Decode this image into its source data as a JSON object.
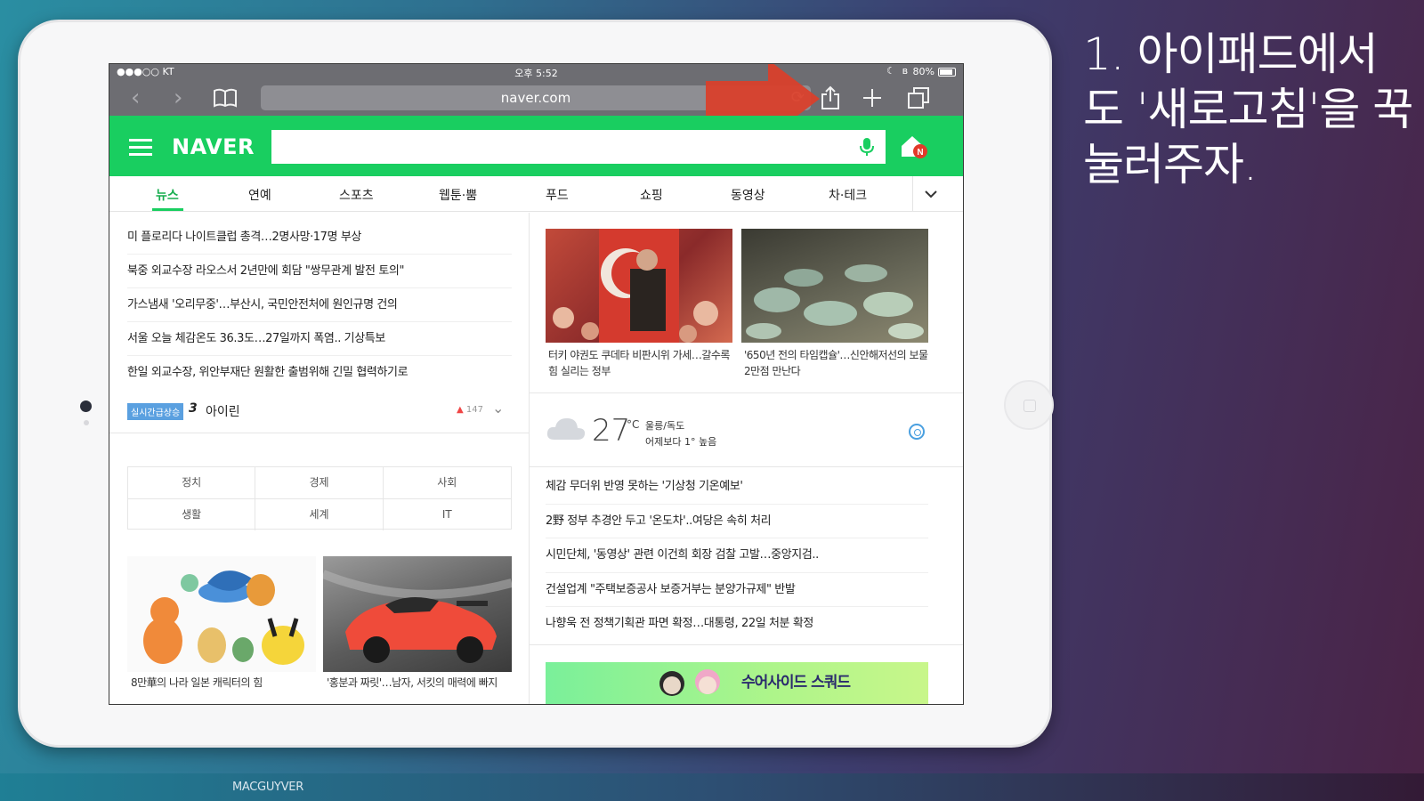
{
  "caption": {
    "line1": "1. 아이패드에서",
    "line2": "도 '새로고침'을 꾹",
    "line3": "눌러주자."
  },
  "footer": {
    "label": "MACGUYVER"
  },
  "statusbar": {
    "carrier": "●●●○○ KT",
    "time": "오후 5:52",
    "battery": "80%"
  },
  "browser": {
    "url": "naver.com",
    "icons": [
      "back-icon",
      "forward-icon",
      "bookmarks-icon",
      "reload-icon",
      "share-icon",
      "new-tab-icon",
      "tabs-icon"
    ]
  },
  "naver": {
    "logo": "NAVER",
    "search_placeholder": ""
  },
  "tabs": [
    "뉴스",
    "연예",
    "스포츠",
    "웹툰·뿜",
    "푸드",
    "쇼핑",
    "동영상",
    "차·테크"
  ],
  "left_news": [
    "미 플로리다 나이트클럽 총격…2명사망·17명 부상",
    "북중 외교수장 라오스서 2년만에 회담 \"쌍무관계 발전 토의\"",
    "가스냄새 '오리무중'…부산시, 국민안전처에 원인규명 건의",
    "서울 오늘 체감온도 36.3도…27일까지 폭염..  기상특보",
    "한일 외교수장, 위안부재단 원활한 출범위해 긴밀 협력하기로"
  ],
  "trending": {
    "badge": "실시간급상승",
    "rank": "3",
    "word": "아이린",
    "count": "147"
  },
  "categories": [
    "정치",
    "경제",
    "사회",
    "생활",
    "세계",
    "IT"
  ],
  "left_thumbs": [
    {
      "caption": "8만華의 나라 일본 캐릭터의 힘"
    },
    {
      "caption": "'홍분과 짜릿'…남자, 서킷의 매력에 빠지"
    }
  ],
  "right_thumbs": [
    {
      "caption": "터키 야권도 쿠데타 비판시위 가세…갈수록 힘 실리는 정부"
    },
    {
      "caption": "'650년 전의 타임캡슐'…신안해저선의 보물 2만점 만난다"
    }
  ],
  "weather": {
    "temp": "27",
    "unit": "°C",
    "location": "울릉/독도",
    "compare": "어제보다 1° 높음"
  },
  "right_news": [
    "체감 무더위 반영 못하는 '기상청 기온예보'",
    "2野 정부 추경안 두고 '온도차'..여당은 속히 처리",
    "시민단체, '동영상' 관련 이건희 회장 검찰 고발…중앙지검..",
    "건설업계 \"주택보증공사 보증거부는 분양가규제\" 반발",
    "나향욱 전 정책기획관 파면 확정…대통령, 22일 처분 확정"
  ],
  "ad": {
    "text": "수어사이드 스쿼드"
  },
  "colors": {
    "naver_green": "#19ce60",
    "arrow_red": "#d9402b",
    "toolbar_gray": "#6d6d72"
  }
}
